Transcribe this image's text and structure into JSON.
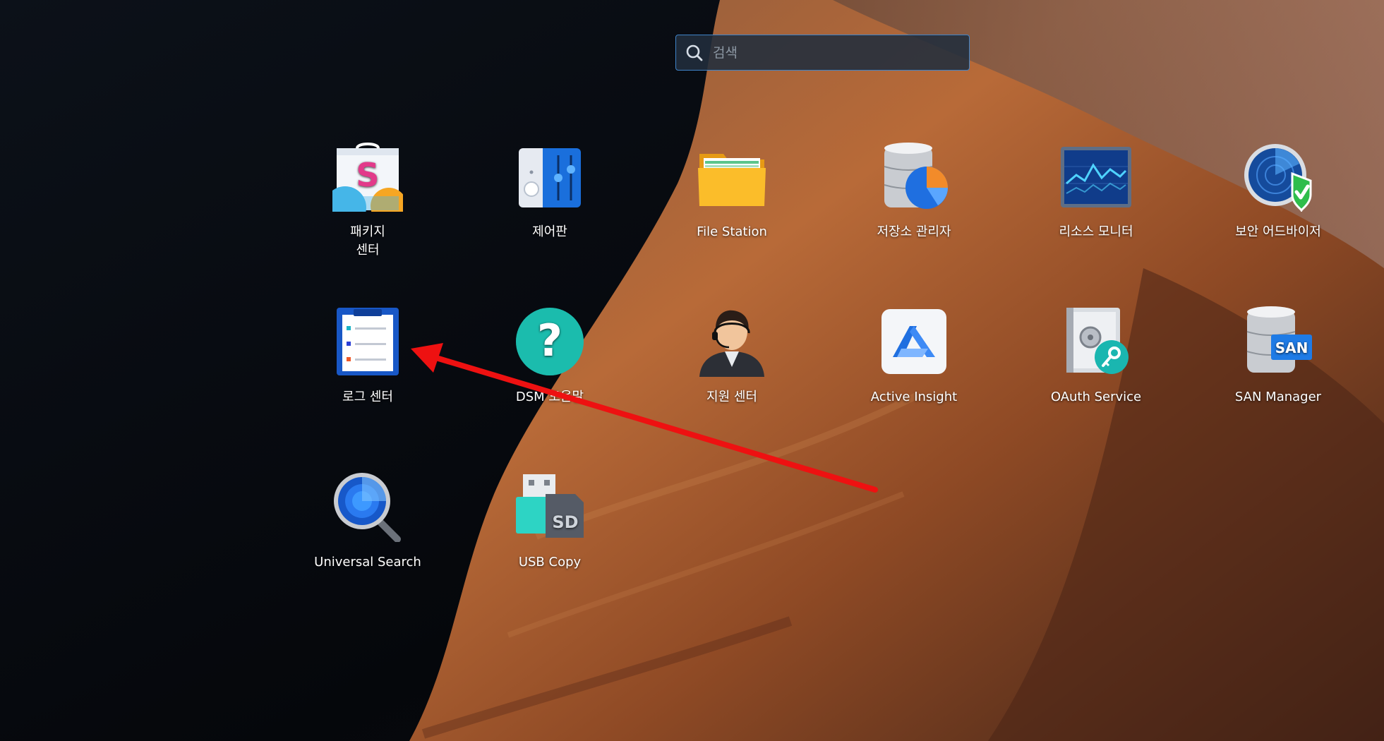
{
  "search": {
    "placeholder": "검색",
    "value": "",
    "icon": "search-icon"
  },
  "apps": [
    {
      "name": "package-center",
      "label": "패키지\n센터",
      "icon": "package-center-icon"
    },
    {
      "name": "control-panel",
      "label": "제어판",
      "icon": "control-panel-icon"
    },
    {
      "name": "file-station",
      "label": "File Station",
      "icon": "folder-icon"
    },
    {
      "name": "storage-manager",
      "label": "저장소 관리자",
      "icon": "storage-manager-icon"
    },
    {
      "name": "resource-monitor",
      "label": "리소스 모니터",
      "icon": "resource-monitor-icon"
    },
    {
      "name": "security-advisor",
      "label": "보안 어드바이저",
      "icon": "security-advisor-icon"
    },
    {
      "name": "log-center",
      "label": "로그 센터",
      "icon": "log-center-icon"
    },
    {
      "name": "dsm-help",
      "label": "DSM 도움말",
      "icon": "help-icon"
    },
    {
      "name": "support-center",
      "label": "지원 센터",
      "icon": "support-agent-icon"
    },
    {
      "name": "active-insight",
      "label": "Active Insight",
      "icon": "active-insight-icon"
    },
    {
      "name": "oauth-service",
      "label": "OAuth Service",
      "icon": "oauth-key-icon"
    },
    {
      "name": "san-manager",
      "label": "SAN Manager",
      "icon": "san-manager-icon"
    },
    {
      "name": "universal-search",
      "label": "Universal Search",
      "icon": "magnifier-icon"
    },
    {
      "name": "usb-copy",
      "label": "USB Copy",
      "icon": "usb-copy-icon"
    }
  ],
  "annotation": {
    "type": "arrow",
    "color": "#ee1111",
    "target": "log-center"
  },
  "colors": {
    "accent": "#3f84c9",
    "background_dark": "#06090f",
    "rock_orange": "#c06a34"
  }
}
